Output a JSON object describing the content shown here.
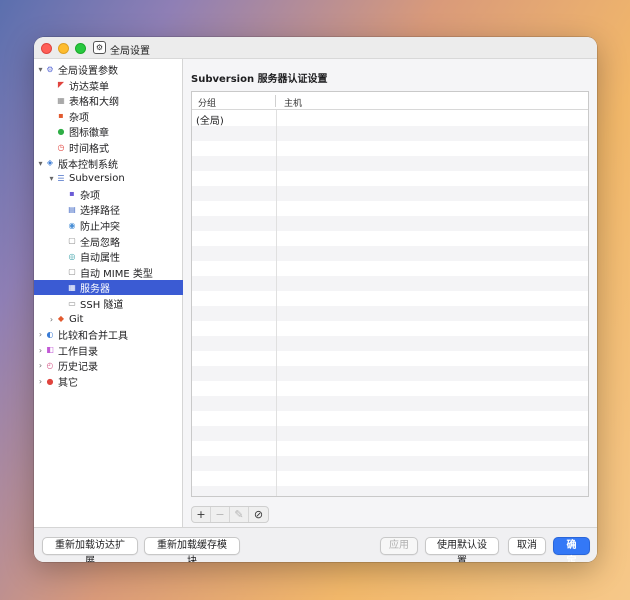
{
  "window": {
    "title": "全局设置"
  },
  "sidebar": {
    "items": [
      {
        "label": "全局设置参数",
        "level": 0,
        "arrow": "▾",
        "icon": "⚙",
        "iconColor": "#5a6bd6",
        "iconName": "gear-icon",
        "selected": false
      },
      {
        "label": "访达菜单",
        "level": 1,
        "arrow": "",
        "icon": "◤",
        "iconColor": "#e0443e",
        "iconName": "finder-menu-icon",
        "selected": false
      },
      {
        "label": "表格和大纲",
        "level": 1,
        "arrow": "",
        "icon": "▦",
        "iconColor": "#8a8a8a",
        "iconName": "table-outline-icon",
        "selected": false
      },
      {
        "label": "杂项",
        "level": 1,
        "arrow": "",
        "icon": "▪",
        "iconColor": "#e25a2f",
        "iconName": "misc-icon",
        "selected": false
      },
      {
        "label": "图标徽章",
        "level": 1,
        "arrow": "",
        "icon": "●",
        "iconColor": "#2fae46",
        "iconName": "icon-badge-icon",
        "selected": false
      },
      {
        "label": "时间格式",
        "level": 1,
        "arrow": "",
        "icon": "◷",
        "iconColor": "#e0443e",
        "iconName": "clock-icon",
        "selected": false
      },
      {
        "label": "版本控制系统",
        "level": 0,
        "arrow": "▾",
        "icon": "◈",
        "iconColor": "#3a7bd5",
        "iconName": "version-control-icon",
        "selected": false
      },
      {
        "label": "Subversion",
        "level": 1,
        "arrow": "▾",
        "icon": "☰",
        "iconColor": "#4a6fc7",
        "iconName": "subversion-icon",
        "selected": false
      },
      {
        "label": "杂项",
        "level": 2,
        "arrow": "",
        "icon": "▪",
        "iconColor": "#6b5bd6",
        "iconName": "misc-icon",
        "selected": false
      },
      {
        "label": "选择路径",
        "level": 2,
        "arrow": "",
        "icon": "▤",
        "iconColor": "#4a6fc7",
        "iconName": "select-path-icon",
        "selected": false
      },
      {
        "label": "防止冲突",
        "level": 2,
        "arrow": "",
        "icon": "◉",
        "iconColor": "#4a8fd6",
        "iconName": "prevent-conflict-icon",
        "selected": false
      },
      {
        "label": "全局忽略",
        "level": 2,
        "arrow": "",
        "icon": "▢",
        "iconColor": "#888888",
        "iconName": "global-ignore-icon",
        "selected": false
      },
      {
        "label": "自动属性",
        "level": 2,
        "arrow": "",
        "icon": "◎",
        "iconColor": "#3aa0a8",
        "iconName": "auto-props-icon",
        "selected": false
      },
      {
        "label": "自动 MIME 类型",
        "level": 2,
        "arrow": "",
        "icon": "▢",
        "iconColor": "#888888",
        "iconName": "auto-mime-icon",
        "selected": false
      },
      {
        "label": "服务器",
        "level": 2,
        "arrow": "",
        "icon": "▦",
        "iconColor": "#7ed37e",
        "iconName": "server-icon",
        "selected": true
      },
      {
        "label": "SSH 隧道",
        "level": 2,
        "arrow": "",
        "icon": "▭",
        "iconColor": "#888888",
        "iconName": "ssh-tunnel-icon",
        "selected": false
      },
      {
        "label": "Git",
        "level": 1,
        "arrow": "›",
        "icon": "◆",
        "iconColor": "#e25a2f",
        "iconName": "git-icon",
        "selected": false
      },
      {
        "label": "比较和合并工具",
        "level": 0,
        "arrow": "›",
        "icon": "◐",
        "iconColor": "#3a7bd5",
        "iconName": "diff-merge-icon",
        "selected": false
      },
      {
        "label": "工作目录",
        "level": 0,
        "arrow": "›",
        "icon": "◧",
        "iconColor": "#c25ad6",
        "iconName": "working-dir-icon",
        "selected": false
      },
      {
        "label": "历史记录",
        "level": 0,
        "arrow": "›",
        "icon": "◴",
        "iconColor": "#d65a8a",
        "iconName": "history-icon",
        "selected": false
      },
      {
        "label": "其它",
        "level": 0,
        "arrow": "›",
        "icon": "●",
        "iconColor": "#e0443e",
        "iconName": "other-icon",
        "selected": false
      }
    ]
  },
  "main": {
    "title": "Subversion 服务器认证设置",
    "table": {
      "columns": [
        "分组",
        "主机"
      ],
      "rows": [
        [
          "(全局)",
          ""
        ]
      ]
    },
    "toolbar": {
      "add": "+",
      "remove": "−",
      "edit": "✎",
      "clear": "⊘"
    }
  },
  "footer": {
    "reload_finder": "重新加载访达扩展",
    "reload_cache": "重新加载缓存模块",
    "apply": "应用",
    "use_defaults": "使用默认设置",
    "cancel": "取消",
    "ok": "确定"
  }
}
